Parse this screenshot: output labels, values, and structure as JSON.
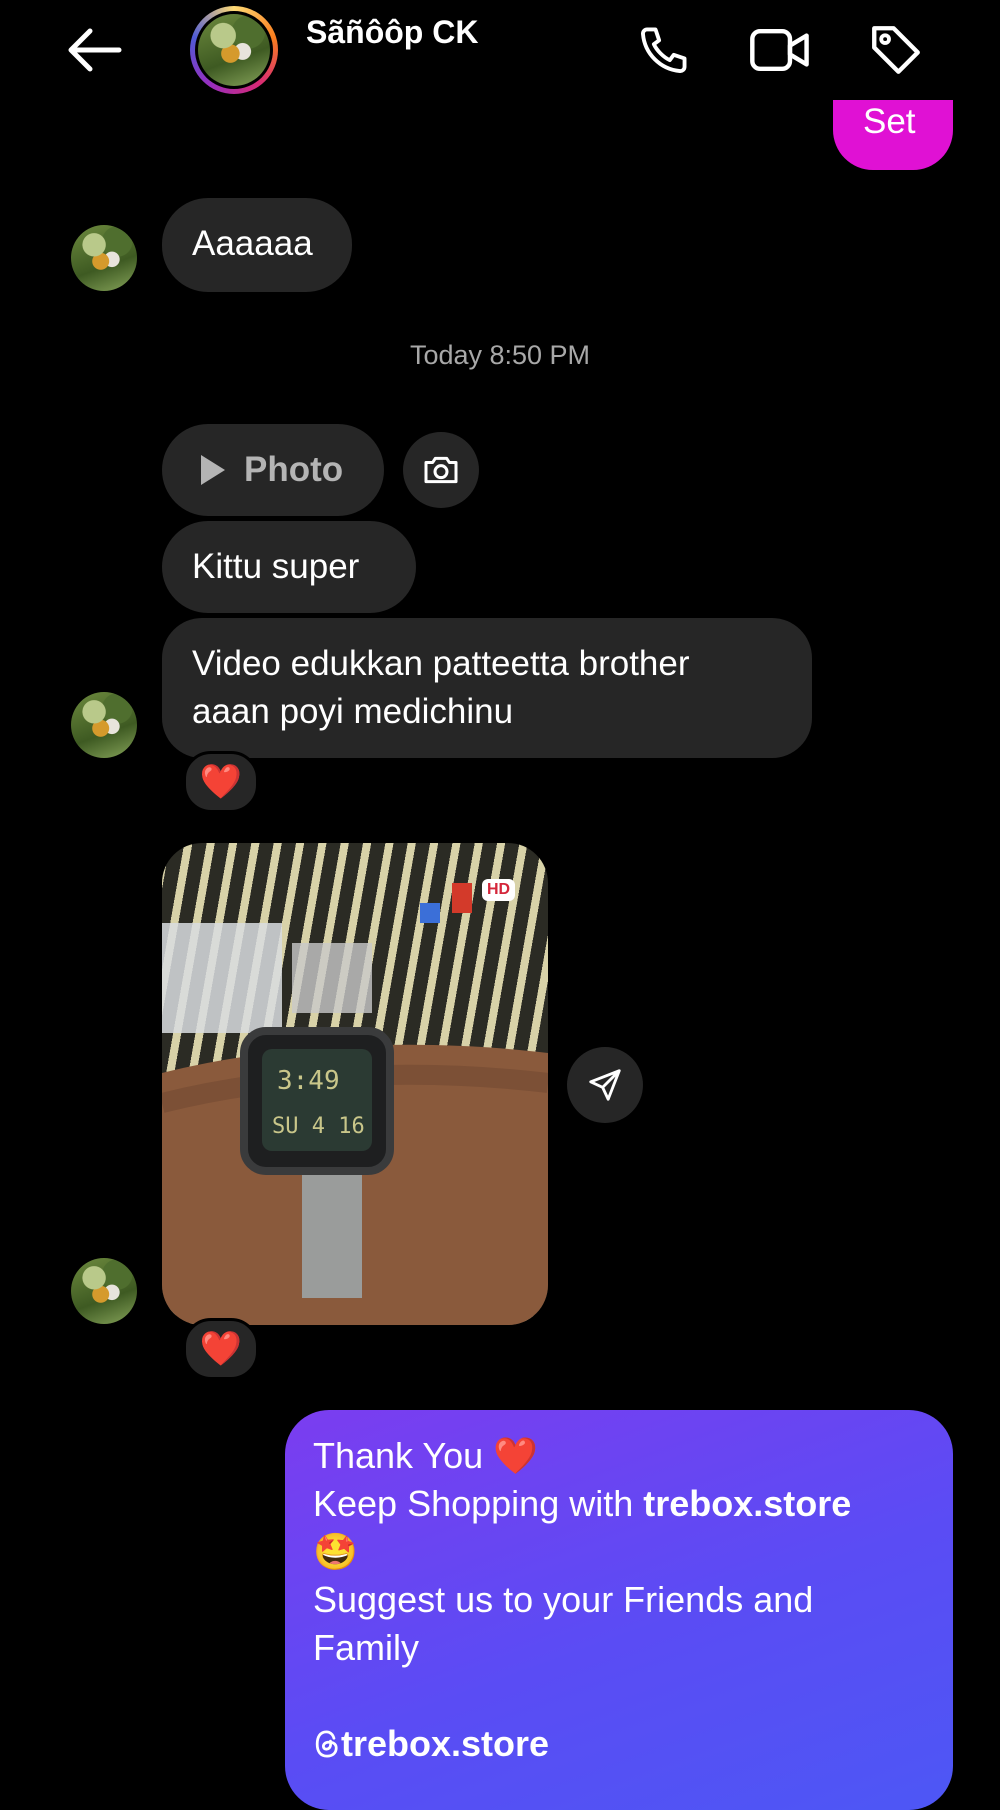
{
  "header": {
    "back_icon": "arrow-left-icon",
    "contact_name": "Sãñôôp CK",
    "call_icon": "phone-icon",
    "video_icon": "video-camera-icon",
    "tag_icon": "tag-icon"
  },
  "messages": {
    "top_sent_partial": "Set",
    "msg1": "Aaaaaa",
    "timestamp": "Today 8:50 PM",
    "photo_label": "Photo",
    "msg2": "Kittu super",
    "msg3_line1": "Video edukkan patteetta brother",
    "msg3_line2": "aaan poyi medichinu",
    "reaction": "❤️",
    "hd_badge": "HD",
    "sent_line1": "Thank You ❤️",
    "sent_line2_prefix": " Keep Shopping with ",
    "sent_line2_bold": "trebox.store",
    "sent_emoji": "🤩",
    "sent_line3": "Suggest us to your Friends and",
    "sent_line4": "Family",
    "sent_handle": "trebox.store"
  },
  "colors": {
    "background": "#000000",
    "received_bubble": "#262626",
    "sent_partial_bubble": "#e011d4",
    "sent_gradient_start": "#7b3df0",
    "sent_gradient_end": "#4d57f5"
  }
}
